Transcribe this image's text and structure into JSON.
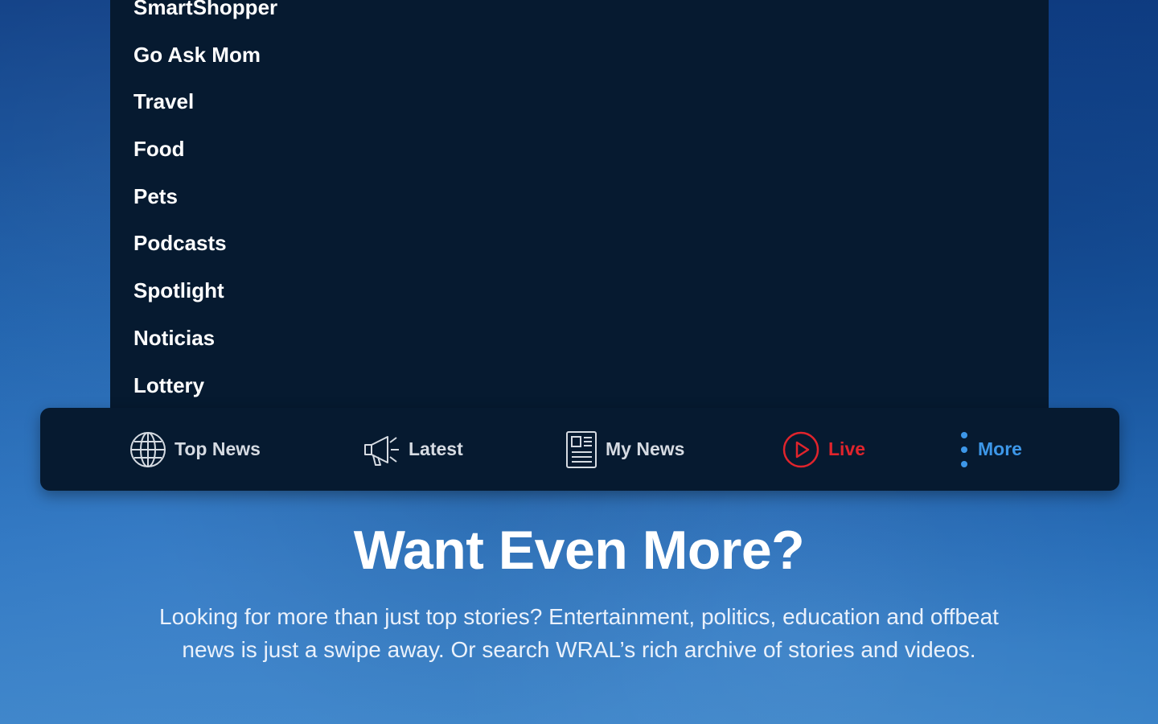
{
  "menu": {
    "items": [
      {
        "label": "SmartShopper"
      },
      {
        "label": "Go Ask Mom"
      },
      {
        "label": "Travel"
      },
      {
        "label": "Food"
      },
      {
        "label": "Pets"
      },
      {
        "label": "Podcasts"
      },
      {
        "label": "Spotlight"
      },
      {
        "label": "Noticias"
      },
      {
        "label": "Lottery"
      }
    ]
  },
  "tabbar": {
    "tabs": [
      {
        "label": "Top News",
        "icon": "globe-icon"
      },
      {
        "label": "Latest",
        "icon": "megaphone-icon"
      },
      {
        "label": "My News",
        "icon": "newspaper-icon"
      },
      {
        "label": "Live",
        "icon": "play-circle-icon"
      },
      {
        "label": "More",
        "icon": "vertical-dots-icon"
      }
    ]
  },
  "hero": {
    "title": "Want Even More?",
    "text": "Looking for more than just top stories? Entertainment, politics, education and offbeat news is just a swipe away. Or search WRAL’s rich archive of stories and videos."
  },
  "colors": {
    "panel": "#061a30",
    "live": "#e0242c",
    "more": "#3d97e8",
    "tab_default": "#d6dbe2"
  }
}
